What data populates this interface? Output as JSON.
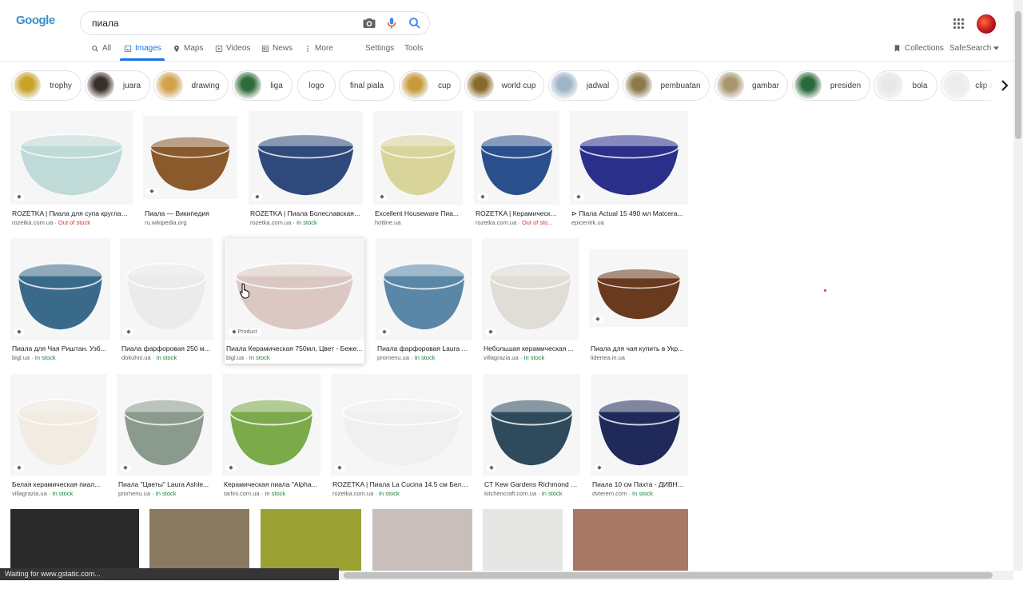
{
  "logo": {
    "text": "Google"
  },
  "search": {
    "query": "пиала"
  },
  "tabs": [
    {
      "label": "All",
      "icon": "search-icon"
    },
    {
      "label": "Images",
      "icon": "image-icon",
      "active": true
    },
    {
      "label": "Maps",
      "icon": "map-pin-icon"
    },
    {
      "label": "Videos",
      "icon": "video-icon"
    },
    {
      "label": "News",
      "icon": "news-icon"
    },
    {
      "label": "More",
      "icon": "more-vert-icon"
    }
  ],
  "tools": {
    "settings": "Settings",
    "tools": "Tools",
    "collections": "Collections",
    "safesearch": "SafeSearch"
  },
  "chips": [
    {
      "label": "trophy",
      "color": "#c9a227"
    },
    {
      "label": "juara",
      "color": "#3a2e2a"
    },
    {
      "label": "drawing",
      "color": "#d4a24c"
    },
    {
      "label": "liga",
      "color": "#2f6b3a"
    },
    {
      "label": "logo",
      "color": ""
    },
    {
      "label": "final piala",
      "color": ""
    },
    {
      "label": "cup",
      "color": "#c79a3a"
    },
    {
      "label": "world cup",
      "color": "#8a6a2a"
    },
    {
      "label": "jadwal",
      "color": "#9fb3c9"
    },
    {
      "label": "pembuatan",
      "color": "#8d7a4a"
    },
    {
      "label": "gambar",
      "color": "#a89670"
    },
    {
      "label": "presiden",
      "color": "#2a6a3a"
    },
    {
      "label": "bola",
      "color": "#e8e8e8"
    },
    {
      "label": "clip art",
      "color": "#ececec"
    }
  ],
  "results": [
    {
      "caption": "ROZETKA | Пиала для супа круглая ...",
      "source": "rozetka.com.ua",
      "stock": "Out of stock",
      "stock_status": "out",
      "color": "#bfdad7"
    },
    {
      "caption": "Пиала — Википедия",
      "source": "ru.wikipedia.org",
      "stock": "",
      "stock_status": "",
      "color": "#8a5a2c"
    },
    {
      "caption": "ROZETKA | Пиала Болеславская ...",
      "source": "rozetka.com.ua",
      "stock": "In stock",
      "stock_status": "in",
      "color": "#2f4a7a"
    },
    {
      "caption": "Excellent Houseware Пиа...",
      "source": "hotline.ua",
      "stock": "",
      "stock_status": "",
      "color": "#d8d49a"
    },
    {
      "caption": "ROZETKA | Керамическа...",
      "source": "rozetka.com.ua",
      "stock": "Out of sto...",
      "stock_status": "out",
      "color": "#2b4f8c"
    },
    {
      "caption": "⊳ Піала Actual 15 490 мл Matcera...",
      "source": "epicentrk.ua",
      "stock": "",
      "stock_status": "",
      "color": "#2a2f8a"
    },
    {
      "caption": "Пиала для Чая Риштан. Узб...",
      "source": "bigl.ua",
      "stock": "In stock",
      "stock_status": "in",
      "color": "#3a6a8a"
    },
    {
      "caption": "Пиала фарфоровая 250 м...",
      "source": "dokuhni.ua",
      "stock": "In stock",
      "stock_status": "in",
      "color": "#ebebeb"
    },
    {
      "caption": "Пиала Керамическая 750мл, Цвет - Беже...",
      "source": "bigl.ua",
      "stock": "In stock",
      "stock_status": "in",
      "color": "#dcc8c2",
      "product": "Product"
    },
    {
      "caption": "Пиала фарфоровая Laura A...",
      "source": "promenu.ua",
      "stock": "In stock",
      "stock_status": "in",
      "color": "#5a86a8"
    },
    {
      "caption": "Небольшая керамическая ...",
      "source": "villagrazia.ua",
      "stock": "In stock",
      "stock_status": "in",
      "color": "#e0dcd6"
    },
    {
      "caption": "Пиала для чая купить в Укр...",
      "source": "lidertea.in.ua",
      "stock": "",
      "stock_status": "",
      "color": "#6a3a1e"
    },
    {
      "caption": "Белая керамическая пиал...",
      "source": "villagrazia.ua",
      "stock": "In stock",
      "stock_status": "in",
      "color": "#f1ebe2"
    },
    {
      "caption": "Пиала \"Цветы\" Laura Ashle...",
      "source": "promenu.ua",
      "stock": "In stock",
      "stock_status": "in",
      "color": "#8a9a8c"
    },
    {
      "caption": "Керамическая пиала \"Alpha...",
      "source": "tarlini.com.ua",
      "stock": "In stock",
      "stock_status": "in",
      "color": "#7aaa4a"
    },
    {
      "caption": "ROZETKA | Пиала La Cucina 14.5 см Бела...",
      "source": "rozetka.com.ua",
      "stock": "In stock",
      "stock_status": "in",
      "color": "#f0f0f0"
    },
    {
      "caption": "CT Kew Gardens Richmond П...",
      "source": "kitchencraft.com.ua",
      "stock": "In stock",
      "stock_status": "in",
      "color": "#2e4a5c"
    },
    {
      "caption": "Пиала 10 см Пахта - ДИВН...",
      "source": "dvterem.com",
      "stock": "In stock",
      "stock_status": "in",
      "color": "#1f2a5a"
    },
    {
      "caption": "",
      "source": "",
      "stock": "",
      "stock_status": "",
      "color": "#2a2a2a"
    },
    {
      "caption": "",
      "source": "",
      "stock": "",
      "stock_status": "",
      "color": "#8a7a62"
    },
    {
      "caption": "",
      "source": "",
      "stock": "",
      "stock_status": "",
      "color": "#9aa032"
    },
    {
      "caption": "",
      "source": "",
      "stock": "",
      "stock_status": "",
      "color": "#c8bfbb"
    },
    {
      "caption": "",
      "source": "",
      "stock": "",
      "stock_status": "",
      "color": "#e6e7e4"
    },
    {
      "caption": "",
      "source": "",
      "stock": "",
      "stock_status": "",
      "color": "#a87766"
    }
  ],
  "status_bar": {
    "text": "Waiting for www.gstatic.com..."
  }
}
